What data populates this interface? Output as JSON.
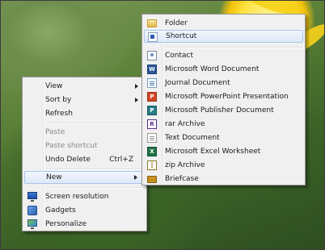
{
  "context_menu": {
    "items": [
      {
        "label": "View",
        "submenu": true
      },
      {
        "label": "Sort by",
        "submenu": true
      },
      {
        "label": "Refresh"
      },
      {
        "label": "Paste",
        "disabled": true
      },
      {
        "label": "Paste shortcut",
        "disabled": true
      },
      {
        "label": "Undo Delete",
        "shortcut": "Ctrl+Z"
      },
      {
        "label": "New",
        "submenu": true,
        "highlighted": true
      },
      {
        "label": "Screen resolution",
        "icon": "screen-resolution-icon"
      },
      {
        "label": "Gadgets",
        "icon": "gadgets-icon"
      },
      {
        "label": "Personalize",
        "icon": "personalize-icon"
      }
    ]
  },
  "new_submenu": {
    "items": [
      {
        "label": "Folder",
        "icon": "folder-icon"
      },
      {
        "label": "Shortcut",
        "icon": "shortcut-icon",
        "highlighted": true
      },
      {
        "label": "Contact",
        "icon": "contact-icon"
      },
      {
        "label": "Microsoft Word Document",
        "icon": "word-document-icon",
        "glyph": "W"
      },
      {
        "label": "Journal Document",
        "icon": "journal-document-icon"
      },
      {
        "label": "Microsoft PowerPoint Presentation",
        "icon": "powerpoint-icon",
        "glyph": "P"
      },
      {
        "label": "Microsoft Publisher Document",
        "icon": "publisher-icon",
        "glyph": "P"
      },
      {
        "label": "rar Archive",
        "icon": "rar-archive-icon",
        "glyph": "R"
      },
      {
        "label": "Text Document",
        "icon": "text-document-icon"
      },
      {
        "label": "Microsoft Excel Worksheet",
        "icon": "excel-icon",
        "glyph": "X"
      },
      {
        "label": "zip Archive",
        "icon": "zip-archive-icon"
      },
      {
        "label": "Briefcase",
        "icon": "briefcase-icon"
      }
    ]
  },
  "colors": {
    "highlight_border": "#a8c6ee",
    "menu_background": "#f0f0f0",
    "disabled_text": "#8a8a8a"
  }
}
